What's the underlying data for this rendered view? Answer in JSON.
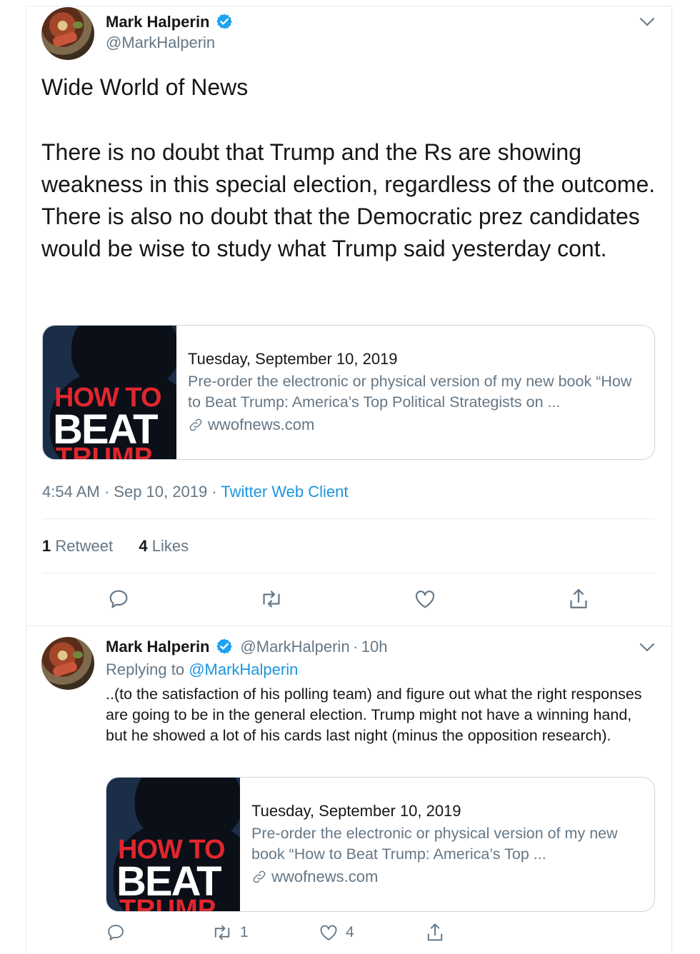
{
  "tweet": {
    "author_name": "Mark Halperin",
    "author_handle": "@MarkHalperin",
    "text_title": "Wide World of News",
    "text_body": "There is no doubt that Trump and the Rs are showing weakness in this special election, regardless of the outcome. There is  also no doubt that the Democratic prez candidates would be wise to study what Trump said yesterday cont.",
    "card": {
      "image_text_top": "HOW TO",
      "image_text_mid": "BEAT",
      "image_text_bottom": "TRUMP",
      "title": "Tuesday, September 10, 2019",
      "description": "Pre-order the electronic or physical version of my new book “How to Beat Trump: America’s Top Political Strategists on ...",
      "domain": "wwofnews.com"
    },
    "time": "4:54 AM",
    "date": "Sep 10, 2019",
    "separator": "·",
    "client": "Twitter Web Client",
    "retweet_count": "1",
    "retweet_label": "Retweet",
    "like_count": "4",
    "like_label": "Likes"
  },
  "reply": {
    "author_name": "Mark Halperin",
    "author_handle": "@MarkHalperin",
    "age": "10h",
    "separator": "·",
    "replying_prefix": "Replying to",
    "replying_handle": "@MarkHalperin",
    "text": "..(to the satisfaction of his polling  team) and figure out what the right responses are going to be in the general election.  Trump might not have a winning hand, but he showed a  lot of his cards last night (minus the opposition research).",
    "card": {
      "image_text_top": "HOW TO",
      "image_text_mid": "BEAT",
      "image_text_bottom": "TRUMP",
      "title": "Tuesday, September 10, 2019",
      "description": "Pre-order the electronic or physical version of my new book “How to Beat Trump: America’s Top ...",
      "domain": "wwofnews.com"
    },
    "retweet_count": "1",
    "like_count": "4"
  },
  "colors": {
    "accent": "#1b95e0",
    "muted": "#657786",
    "border": "#e6ecf0",
    "verified": "#1da1f2"
  },
  "icons": {
    "verified": "verified-badge-icon",
    "more": "chevron-down-icon",
    "reply": "reply-icon",
    "retweet": "retweet-icon",
    "like": "heart-icon",
    "share": "share-icon",
    "link": "link-icon"
  }
}
